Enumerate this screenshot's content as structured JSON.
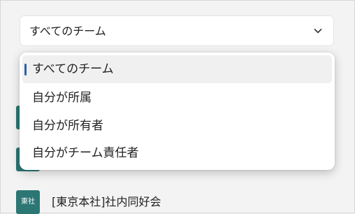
{
  "team_filter": {
    "selected_value": "すべてのチーム",
    "options": [
      {
        "label": "すべてのチーム"
      },
      {
        "label": "自分が所属"
      },
      {
        "label": "自分が所有者"
      },
      {
        "label": "自分がチーム責任者"
      }
    ]
  },
  "teams": [
    {
      "avatar_text": "",
      "name": ""
    },
    {
      "avatar_text": "",
      "name": ""
    },
    {
      "avatar_text": "東社",
      "name": "[東京本社]社内同好会"
    }
  ],
  "colors": {
    "avatar_bg": "#2c7674",
    "selected_indicator": "#2f5fa7"
  }
}
